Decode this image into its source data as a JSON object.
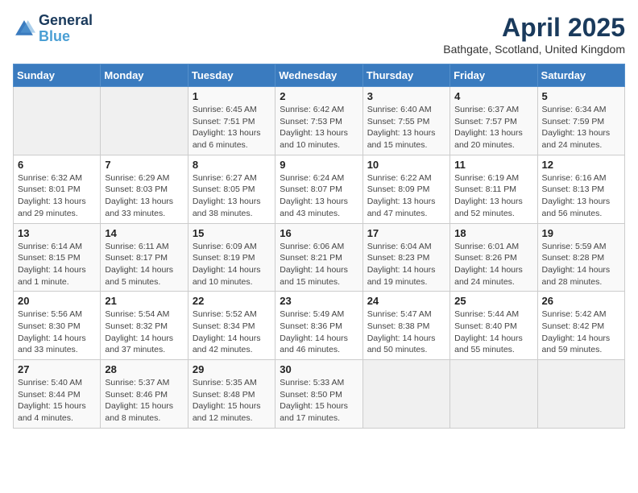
{
  "header": {
    "logo_line1": "General",
    "logo_line2": "Blue",
    "month": "April 2025",
    "location": "Bathgate, Scotland, United Kingdom"
  },
  "days_of_week": [
    "Sunday",
    "Monday",
    "Tuesday",
    "Wednesday",
    "Thursday",
    "Friday",
    "Saturday"
  ],
  "weeks": [
    [
      {
        "day": "",
        "info": ""
      },
      {
        "day": "",
        "info": ""
      },
      {
        "day": "1",
        "info": "Sunrise: 6:45 AM\nSunset: 7:51 PM\nDaylight: 13 hours and 6 minutes."
      },
      {
        "day": "2",
        "info": "Sunrise: 6:42 AM\nSunset: 7:53 PM\nDaylight: 13 hours and 10 minutes."
      },
      {
        "day": "3",
        "info": "Sunrise: 6:40 AM\nSunset: 7:55 PM\nDaylight: 13 hours and 15 minutes."
      },
      {
        "day": "4",
        "info": "Sunrise: 6:37 AM\nSunset: 7:57 PM\nDaylight: 13 hours and 20 minutes."
      },
      {
        "day": "5",
        "info": "Sunrise: 6:34 AM\nSunset: 7:59 PM\nDaylight: 13 hours and 24 minutes."
      }
    ],
    [
      {
        "day": "6",
        "info": "Sunrise: 6:32 AM\nSunset: 8:01 PM\nDaylight: 13 hours and 29 minutes."
      },
      {
        "day": "7",
        "info": "Sunrise: 6:29 AM\nSunset: 8:03 PM\nDaylight: 13 hours and 33 minutes."
      },
      {
        "day": "8",
        "info": "Sunrise: 6:27 AM\nSunset: 8:05 PM\nDaylight: 13 hours and 38 minutes."
      },
      {
        "day": "9",
        "info": "Sunrise: 6:24 AM\nSunset: 8:07 PM\nDaylight: 13 hours and 43 minutes."
      },
      {
        "day": "10",
        "info": "Sunrise: 6:22 AM\nSunset: 8:09 PM\nDaylight: 13 hours and 47 minutes."
      },
      {
        "day": "11",
        "info": "Sunrise: 6:19 AM\nSunset: 8:11 PM\nDaylight: 13 hours and 52 minutes."
      },
      {
        "day": "12",
        "info": "Sunrise: 6:16 AM\nSunset: 8:13 PM\nDaylight: 13 hours and 56 minutes."
      }
    ],
    [
      {
        "day": "13",
        "info": "Sunrise: 6:14 AM\nSunset: 8:15 PM\nDaylight: 14 hours and 1 minute."
      },
      {
        "day": "14",
        "info": "Sunrise: 6:11 AM\nSunset: 8:17 PM\nDaylight: 14 hours and 5 minutes."
      },
      {
        "day": "15",
        "info": "Sunrise: 6:09 AM\nSunset: 8:19 PM\nDaylight: 14 hours and 10 minutes."
      },
      {
        "day": "16",
        "info": "Sunrise: 6:06 AM\nSunset: 8:21 PM\nDaylight: 14 hours and 15 minutes."
      },
      {
        "day": "17",
        "info": "Sunrise: 6:04 AM\nSunset: 8:23 PM\nDaylight: 14 hours and 19 minutes."
      },
      {
        "day": "18",
        "info": "Sunrise: 6:01 AM\nSunset: 8:26 PM\nDaylight: 14 hours and 24 minutes."
      },
      {
        "day": "19",
        "info": "Sunrise: 5:59 AM\nSunset: 8:28 PM\nDaylight: 14 hours and 28 minutes."
      }
    ],
    [
      {
        "day": "20",
        "info": "Sunrise: 5:56 AM\nSunset: 8:30 PM\nDaylight: 14 hours and 33 minutes."
      },
      {
        "day": "21",
        "info": "Sunrise: 5:54 AM\nSunset: 8:32 PM\nDaylight: 14 hours and 37 minutes."
      },
      {
        "day": "22",
        "info": "Sunrise: 5:52 AM\nSunset: 8:34 PM\nDaylight: 14 hours and 42 minutes."
      },
      {
        "day": "23",
        "info": "Sunrise: 5:49 AM\nSunset: 8:36 PM\nDaylight: 14 hours and 46 minutes."
      },
      {
        "day": "24",
        "info": "Sunrise: 5:47 AM\nSunset: 8:38 PM\nDaylight: 14 hours and 50 minutes."
      },
      {
        "day": "25",
        "info": "Sunrise: 5:44 AM\nSunset: 8:40 PM\nDaylight: 14 hours and 55 minutes."
      },
      {
        "day": "26",
        "info": "Sunrise: 5:42 AM\nSunset: 8:42 PM\nDaylight: 14 hours and 59 minutes."
      }
    ],
    [
      {
        "day": "27",
        "info": "Sunrise: 5:40 AM\nSunset: 8:44 PM\nDaylight: 15 hours and 4 minutes."
      },
      {
        "day": "28",
        "info": "Sunrise: 5:37 AM\nSunset: 8:46 PM\nDaylight: 15 hours and 8 minutes."
      },
      {
        "day": "29",
        "info": "Sunrise: 5:35 AM\nSunset: 8:48 PM\nDaylight: 15 hours and 12 minutes."
      },
      {
        "day": "30",
        "info": "Sunrise: 5:33 AM\nSunset: 8:50 PM\nDaylight: 15 hours and 17 minutes."
      },
      {
        "day": "",
        "info": ""
      },
      {
        "day": "",
        "info": ""
      },
      {
        "day": "",
        "info": ""
      }
    ]
  ]
}
